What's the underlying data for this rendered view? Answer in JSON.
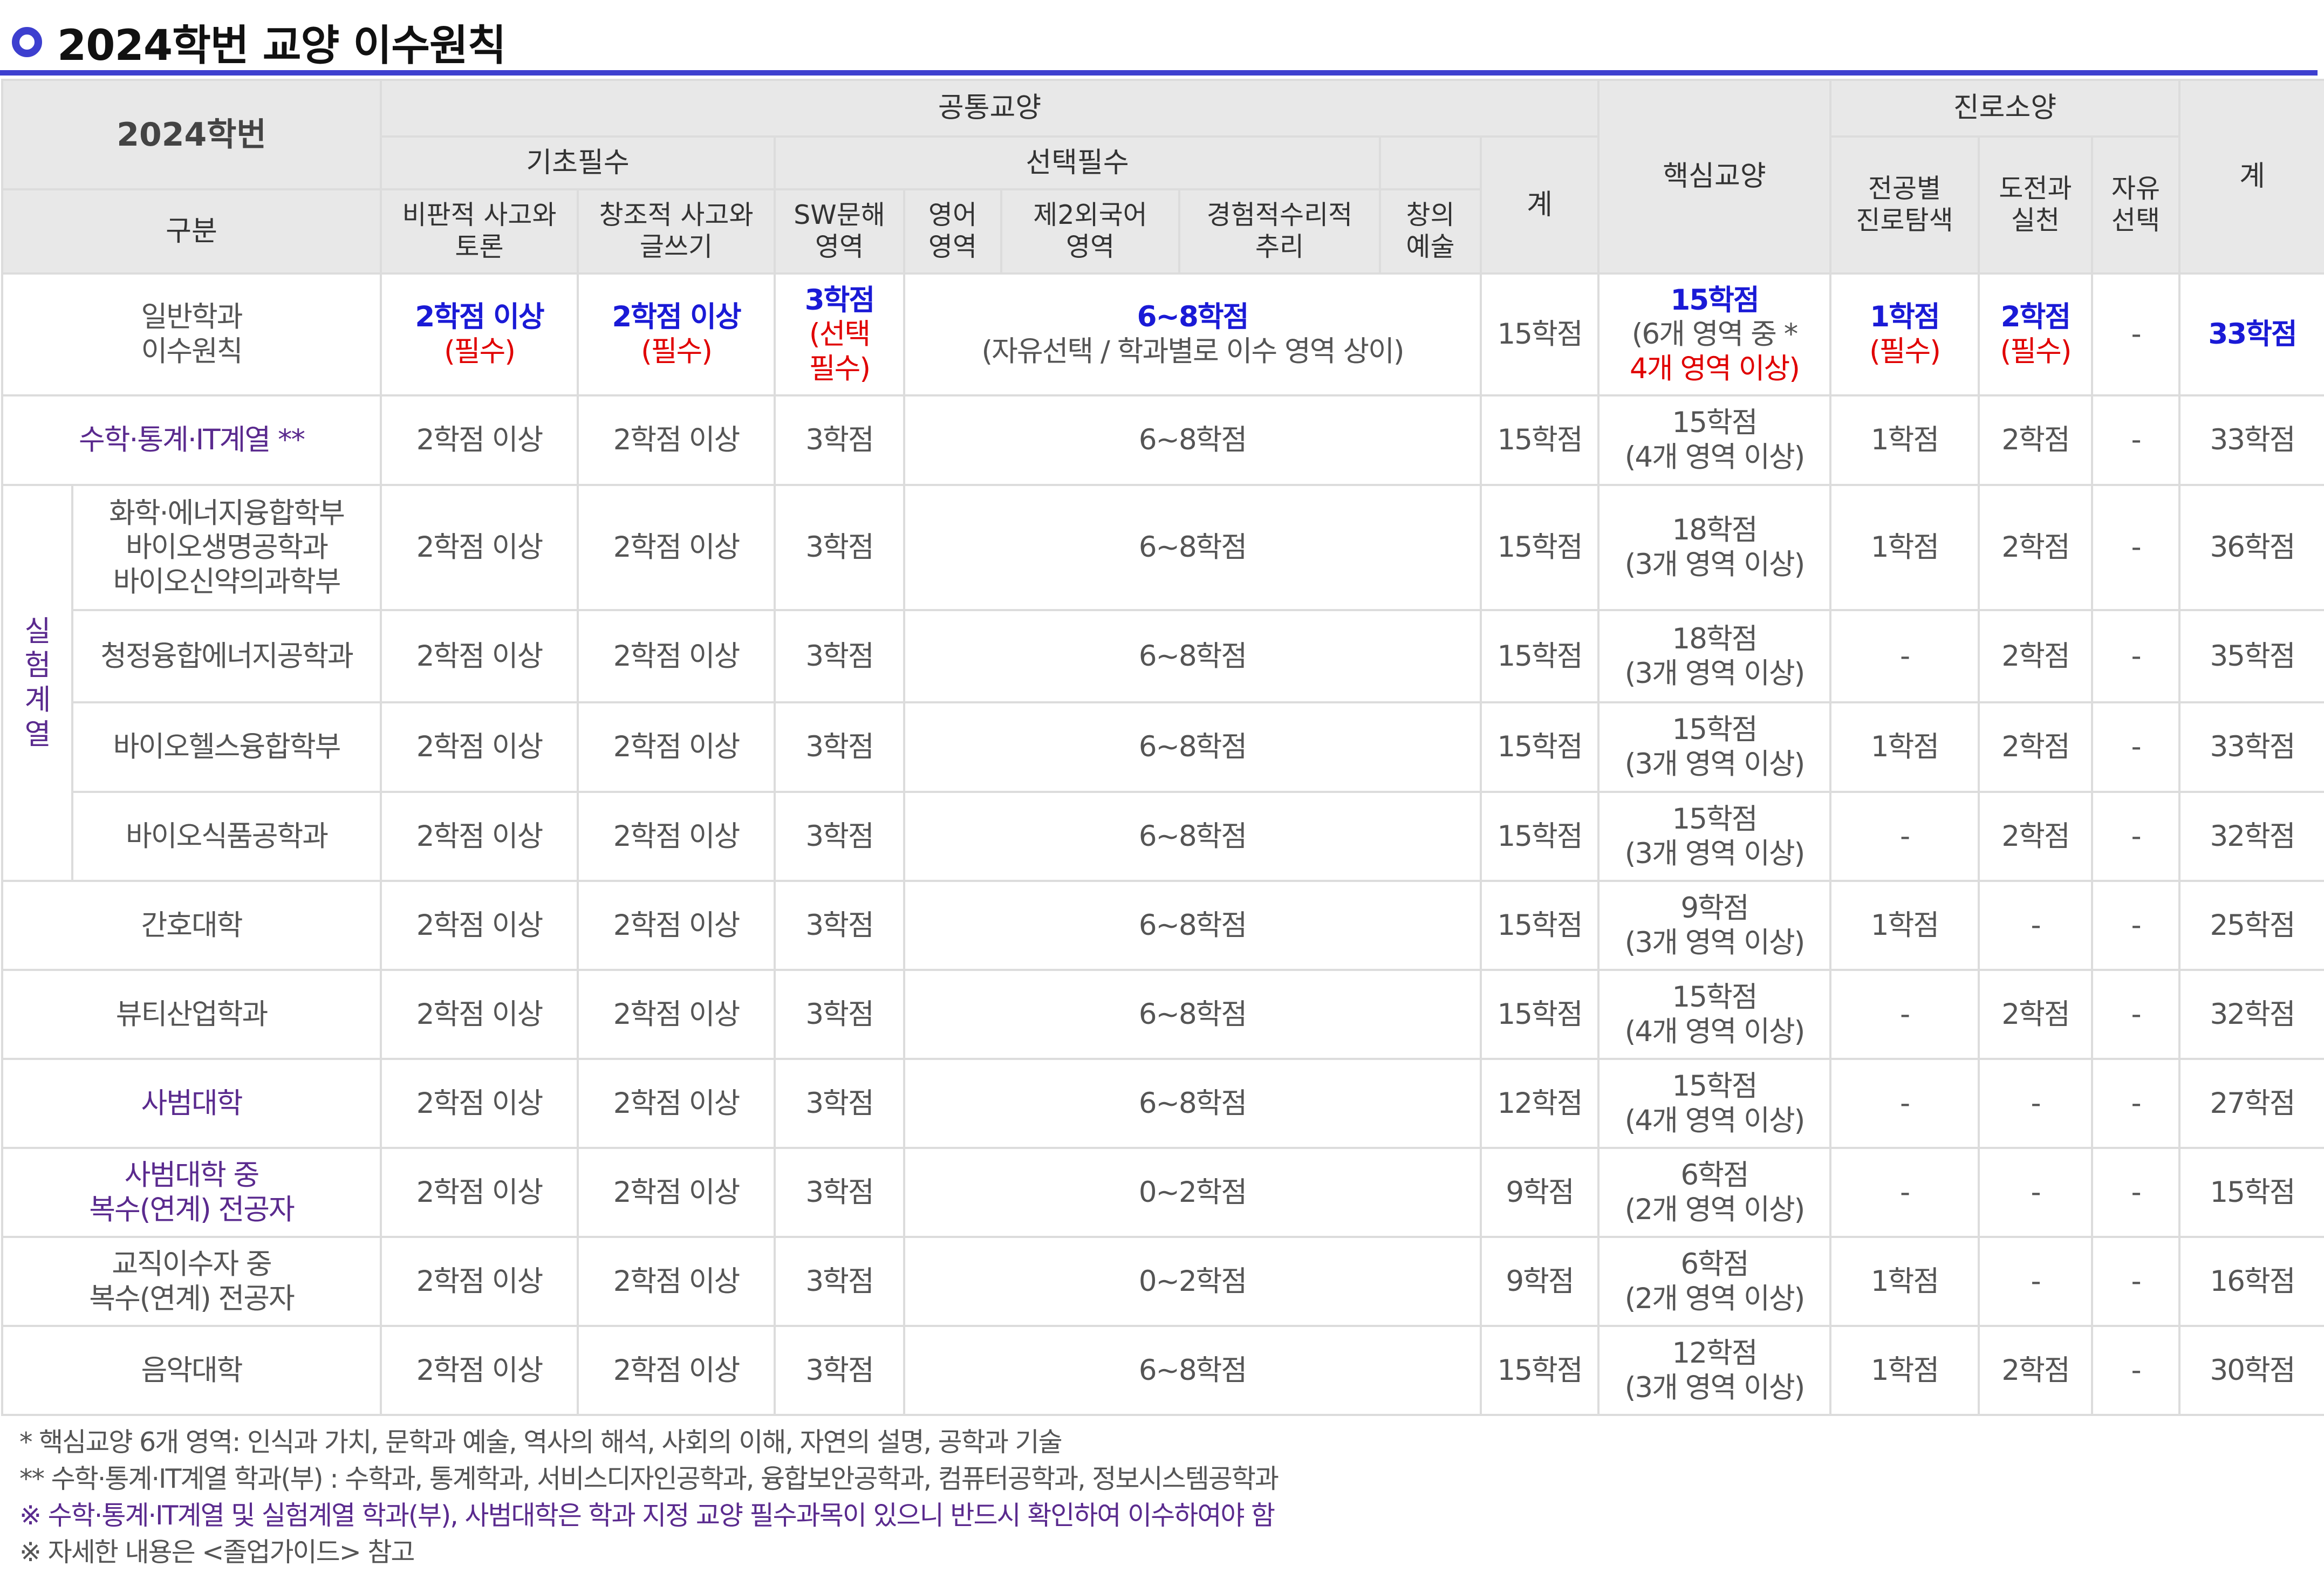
{
  "title": "2024학번 교양 이수원칙",
  "header": {
    "corner_top": "2024학번",
    "corner_bottom": "구분",
    "gongtong": "공통교양",
    "gicho": "기초필수",
    "seontaek": "선택필수",
    "core": "핵심교양",
    "jinro": "진로소양",
    "total": "계",
    "gongtong_total": "계",
    "columns": {
      "critical_1": "비판적 사고와",
      "critical_2": "토론",
      "creative_1": "창조적 사고와",
      "creative_2": "글쓰기",
      "sw_1": "SW문해",
      "sw_2": "영역",
      "eng_1": "영어",
      "eng_2": "영역",
      "lang2_1": "제2외국어",
      "lang2_2": "영역",
      "math_1": "경험적수리적",
      "math_2": "추리",
      "art_1": "창의",
      "art_2": "예술",
      "major_1": "전공별",
      "major_2": "진로탐색",
      "challenge_1": "도전과",
      "challenge_2": "실천",
      "free_1": "자유",
      "free_2": "선택"
    }
  },
  "general_row": {
    "label_1": "일반학과",
    "label_2": "이수원칙",
    "critical": "2학점 이상",
    "critical_note": "(필수)",
    "creative": "2학점 이상",
    "creative_note": "(필수)",
    "sw": "3학점",
    "sw_note_1": "(선택",
    "sw_note_2": "필수)",
    "select": "6~8학점",
    "select_note": "(자유선택 / 학과별로 이수 영역 상이)",
    "subtotal": "15학점",
    "core": "15학점",
    "core_note_1": "(6개 영역 중 *",
    "core_note_2": "4개 영역 이상)",
    "major": "1학점",
    "major_note": "(필수)",
    "challenge": "2학점",
    "challenge_note": "(필수)",
    "free": "-",
    "total": "33학점"
  },
  "exp_group_label": [
    "실",
    "험",
    "계",
    "열"
  ],
  "rows": [
    {
      "label": "수학·통계·IT계열 **",
      "critical": "2학점 이상",
      "creative": "2학점 이상",
      "sw": "3학점",
      "select": "6~8학점",
      "subtotal": "15학점",
      "core_1": "15학점",
      "core_2": "(4개 영역 이상)",
      "major": "1학점",
      "challenge": "2학점",
      "free": "-",
      "total": "33학점"
    },
    {
      "label_lines": [
        "화학·에너지융합학부",
        "바이오생명공학과",
        "바이오신약의과학부"
      ],
      "critical": "2학점 이상",
      "creative": "2학점 이상",
      "sw": "3학점",
      "select": "6~8학점",
      "subtotal": "15학점",
      "core_1": "18학점",
      "core_2": "(3개 영역 이상)",
      "major": "1학점",
      "challenge": "2학점",
      "free": "-",
      "total": "36학점"
    },
    {
      "label": "청정융합에너지공학과",
      "critical": "2학점 이상",
      "creative": "2학점 이상",
      "sw": "3학점",
      "select": "6~8학점",
      "subtotal": "15학점",
      "core_1": "18학점",
      "core_2": "(3개 영역 이상)",
      "major": "-",
      "challenge": "2학점",
      "free": "-",
      "total": "35학점"
    },
    {
      "label": "바이오헬스융합학부",
      "critical": "2학점 이상",
      "creative": "2학점 이상",
      "sw": "3학점",
      "select": "6~8학점",
      "subtotal": "15학점",
      "core_1": "15학점",
      "core_2": "(3개 영역 이상)",
      "major": "1학점",
      "challenge": "2학점",
      "free": "-",
      "total": "33학점"
    },
    {
      "label": "바이오식품공학과",
      "critical": "2학점 이상",
      "creative": "2학점 이상",
      "sw": "3학점",
      "select": "6~8학점",
      "subtotal": "15학점",
      "core_1": "15학점",
      "core_2": "(3개 영역 이상)",
      "major": "-",
      "challenge": "2학점",
      "free": "-",
      "total": "32학점"
    },
    {
      "label": "간호대학",
      "critical": "2학점 이상",
      "creative": "2학점 이상",
      "sw": "3학점",
      "select": "6~8학점",
      "subtotal": "15학점",
      "core_1": "9학점",
      "core_2": "(3개 영역 이상)",
      "major": "1학점",
      "challenge": "-",
      "free": "-",
      "total": "25학점"
    },
    {
      "label": "뷰티산업학과",
      "critical": "2학점 이상",
      "creative": "2학점 이상",
      "sw": "3학점",
      "select": "6~8학점",
      "subtotal": "15학점",
      "core_1": "15학점",
      "core_2": "(4개 영역 이상)",
      "major": "-",
      "challenge": "2학점",
      "free": "-",
      "total": "32학점"
    },
    {
      "label": "사범대학",
      "critical": "2학점 이상",
      "creative": "2학점 이상",
      "sw": "3학점",
      "select": "6~8학점",
      "subtotal": "12학점",
      "core_1": "15학점",
      "core_2": "(4개 영역 이상)",
      "major": "-",
      "challenge": "-",
      "free": "-",
      "total": "27학점"
    },
    {
      "label_lines": [
        "사범대학 중",
        "복수(연계) 전공자"
      ],
      "critical": "2학점 이상",
      "creative": "2학점 이상",
      "sw": "3학점",
      "select": "0~2학점",
      "subtotal": "9학점",
      "core_1": "6학점",
      "core_2": "(2개 영역 이상)",
      "major": "-",
      "challenge": "-",
      "free": "-",
      "total": "15학점"
    },
    {
      "label_lines": [
        "교직이수자 중",
        "복수(연계) 전공자"
      ],
      "critical": "2학점 이상",
      "creative": "2학점 이상",
      "sw": "3학점",
      "select": "0~2학점",
      "subtotal": "9학점",
      "core_1": "6학점",
      "core_2": "(2개 영역 이상)",
      "major": "1학점",
      "challenge": "-",
      "free": "-",
      "total": "16학점"
    },
    {
      "label": "음악대학",
      "critical": "2학점 이상",
      "creative": "2학점 이상",
      "sw": "3학점",
      "select": "6~8학점",
      "subtotal": "15학점",
      "core_1": "12학점",
      "core_2": "(3개 영역 이상)",
      "major": "1학점",
      "challenge": "2학점",
      "free": "-",
      "total": "30학점"
    }
  ],
  "notes": [
    "*  핵심교양 6개 영역: 인식과 가치, 문학과 예술, 역사의 해석, 사회의 이해, 자연의 설명, 공학과 기술",
    "**  수학·통계·IT계열 학과(부) : 수학과, 통계학과, 서비스디자인공학과, 융합보안공학과, 컴퓨터공학과, 정보시스템공학과",
    "※  수학·통계·IT계열 및 실험계열 학과(부), 사범대학은 학과 지정 교양 필수과목이 있으니 반드시 확인하여 이수하여야 함",
    "※  자세한  내용은 <졸업가이드> 참고"
  ],
  "colors": {
    "accent": "#3d3fcf",
    "header_bg": "#e8e8e8",
    "purple": "#5a2a8e",
    "blue": "#1a1ad6",
    "red": "#e00000",
    "border": "#dcdcdc"
  }
}
